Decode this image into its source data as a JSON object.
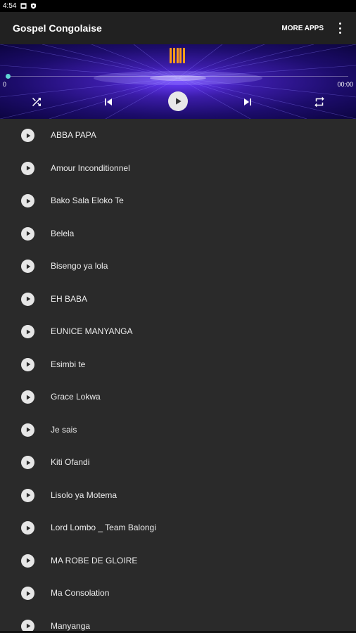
{
  "status_bar": {
    "time": "4:54"
  },
  "app_bar": {
    "title": "Gospel Congolaise",
    "more_apps": "MORE APPS"
  },
  "player": {
    "progress": 0,
    "time_start": "0",
    "time_end": "00:00"
  },
  "songs": [
    {
      "title": "ABBA PAPA"
    },
    {
      "title": "Amour Inconditionnel"
    },
    {
      "title": "Bako Sala Eloko Te"
    },
    {
      "title": "Belela"
    },
    {
      "title": "Bisengo ya lola"
    },
    {
      "title": "EH BABA"
    },
    {
      "title": "EUNICE MANYANGA"
    },
    {
      "title": "Esimbi te"
    },
    {
      "title": "Grace Lokwa"
    },
    {
      "title": "Je sais"
    },
    {
      "title": "Kiti Ofandi"
    },
    {
      "title": "Lisolo ya Motema"
    },
    {
      "title": "Lord Lombo _ Team Balongi"
    },
    {
      "title": "MA ROBE DE GLOIRE"
    },
    {
      "title": "Ma Consolation"
    },
    {
      "title": "Manyanga"
    }
  ],
  "colors": {
    "background": "#2a2a2a",
    "app_bar": "#212121",
    "accent": "#ff9d1a",
    "seek_thumb": "#5fd4d4"
  },
  "icons": {
    "shuffle": "shuffle-icon",
    "previous": "skip-previous-icon",
    "play": "play-icon",
    "next": "skip-next-icon",
    "repeat": "repeat-icon",
    "equalizer": "equalizer-icon",
    "overflow": "more-vert-icon"
  }
}
